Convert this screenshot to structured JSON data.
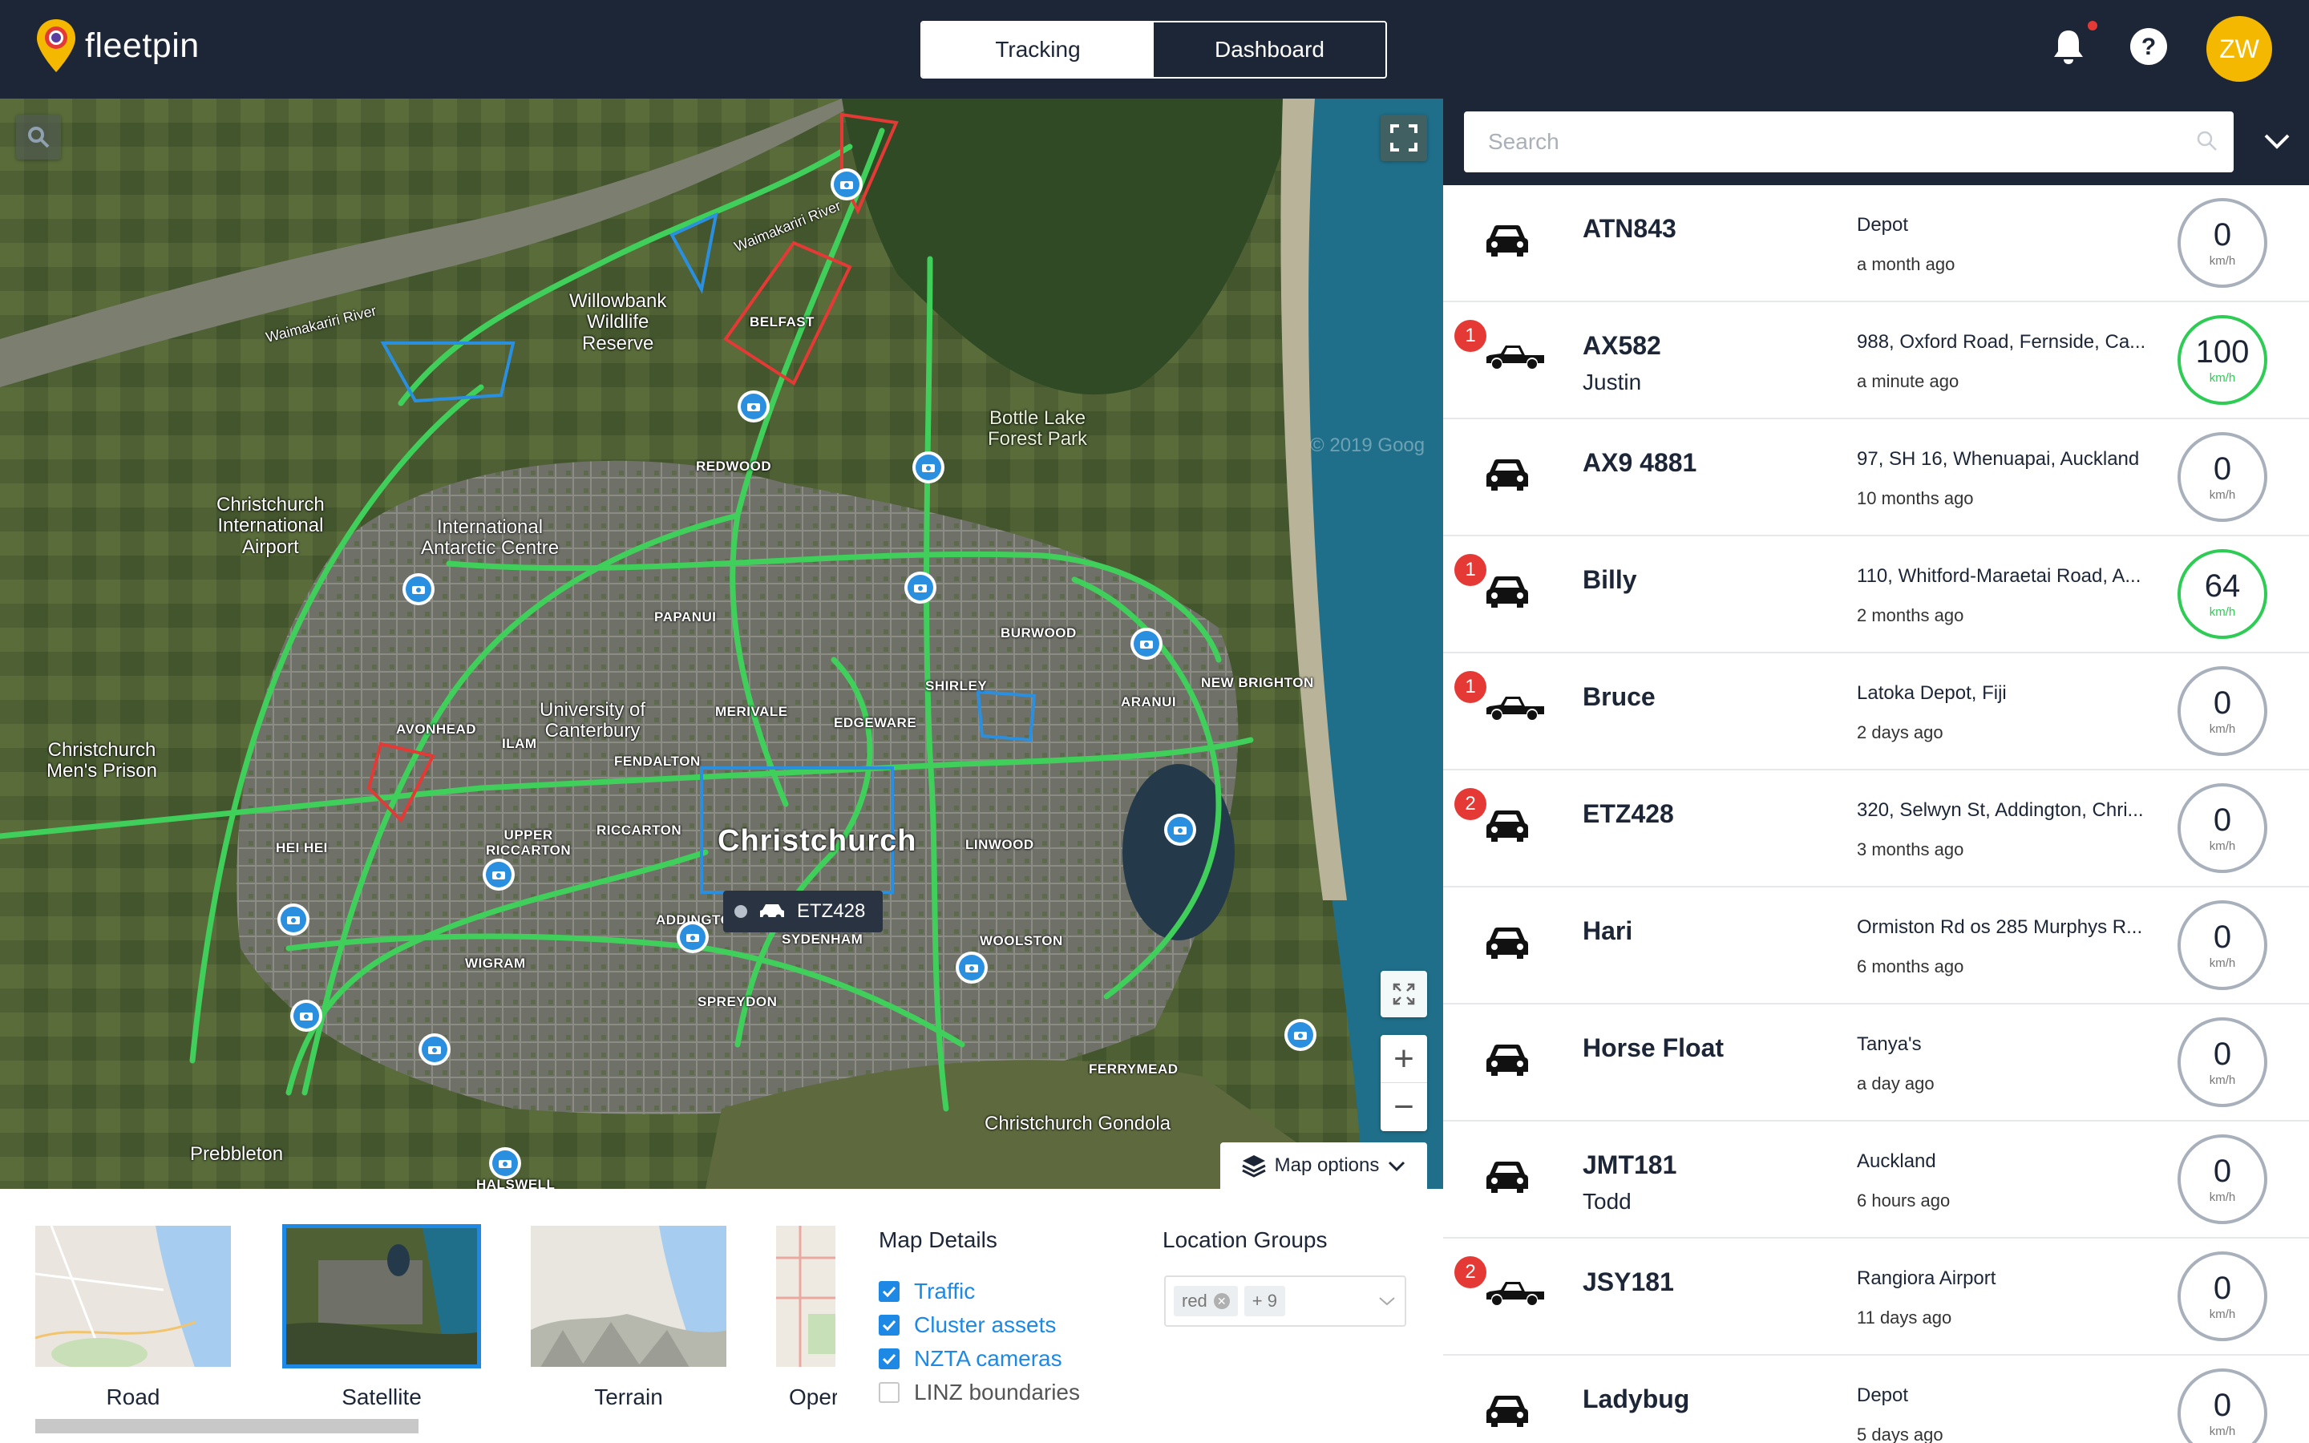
{
  "app": {
    "name": "fleetpin"
  },
  "header": {
    "tabs": [
      {
        "label": "Tracking",
        "active": true
      },
      {
        "label": "Dashboard",
        "active": false
      }
    ],
    "avatar_initials": "ZW",
    "icons": [
      "bell-icon",
      "help-icon"
    ]
  },
  "map": {
    "selected_vehicle": "ETZ428",
    "map_options_label": "Map options",
    "labels": {
      "christchurch": "Christchurch",
      "willowbank": "Willowbank\nWildlife\nReserve",
      "airport": "Christchurch\nInternational\nAirport",
      "antarctic": "International\nAntarctic Centre",
      "bottle_lake": "Bottle Lake\nForest Park",
      "university": "University of\nCanterbury",
      "prison": "Christchurch\nMen's Prison",
      "prebbleton": "Prebbleton",
      "gondola": "Christchurch Gondola",
      "belfast": "BELFAST",
      "redwood": "REDWOOD",
      "papanui": "PAPANUI",
      "burwood": "BURWOOD",
      "shirley": "SHIRLEY",
      "aranui": "ARANUI",
      "new_brighton": "NEW BRIGHTON",
      "merivale": "MERIVALE",
      "edgeware": "EDGEWARE",
      "avonhead": "AVONHEAD",
      "ilam": "ILAM",
      "fendalton": "FENDALTON",
      "riccarton": "RICCARTON",
      "upper_riccarton": "UPPER\nRICCARTON",
      "hei_hei": "HEI HEI",
      "linwood": "LINWOOD",
      "wigram": "WIGRAM",
      "sydenham": "SYDENHAM",
      "addington": "ADDINGTO",
      "spreydon": "SPREYDON",
      "woolston": "WOOLSTON",
      "ferrymead": "FERRYMEAD",
      "halswell": "HALSWELL",
      "waimakariri_river_1": "Waimakariri River",
      "waimakariri_river_2": "Waimakariri River",
      "copyright": "© 2019 Goog"
    }
  },
  "map_panel": {
    "map_types": [
      {
        "label": "Road",
        "selected": false
      },
      {
        "label": "Satellite",
        "selected": true
      },
      {
        "label": "Terrain",
        "selected": false
      },
      {
        "label": "Oper",
        "selected": false
      }
    ],
    "map_details_title": "Map Details",
    "details": [
      {
        "label": "Traffic",
        "checked": true
      },
      {
        "label": "Cluster assets",
        "checked": true
      },
      {
        "label": "NZTA cameras",
        "checked": true
      },
      {
        "label": "LINZ boundaries",
        "checked": false
      }
    ],
    "location_groups_title": "Location Groups",
    "location_groups_tag": "red",
    "location_groups_more": "+ 9"
  },
  "search": {
    "placeholder": "Search"
  },
  "vehicles": [
    {
      "name": "ATN843",
      "driver": "",
      "address": "Depot",
      "time": "a month ago",
      "speed": "0",
      "alerts": "",
      "type": "car"
    },
    {
      "name": "AX582",
      "driver": "Justin",
      "address": "988, Oxford Road, Fernside, Ca...",
      "time": "a minute ago",
      "speed": "100",
      "alerts": "1",
      "type": "ute"
    },
    {
      "name": "AX9 4881",
      "driver": "",
      "address": "97, SH 16, Whenuapai, Auckland",
      "time": "10 months ago",
      "speed": "0",
      "alerts": "",
      "type": "car"
    },
    {
      "name": "Billy",
      "driver": "",
      "address": "110, Whitford-Maraetai Road, A...",
      "time": "2 months ago",
      "speed": "64",
      "alerts": "1",
      "type": "car"
    },
    {
      "name": "Bruce",
      "driver": "",
      "address": "Latoka Depot, Fiji",
      "time": "2 days ago",
      "speed": "0",
      "alerts": "1",
      "type": "ute"
    },
    {
      "name": "ETZ428",
      "driver": "",
      "address": "320, Selwyn St, Addington, Chri...",
      "time": "3 months ago",
      "speed": "0",
      "alerts": "2",
      "type": "car"
    },
    {
      "name": "Hari",
      "driver": "",
      "address": "Ormiston Rd os 285 Murphys R...",
      "time": "6 months ago",
      "speed": "0",
      "alerts": "",
      "type": "car"
    },
    {
      "name": "Horse Float",
      "driver": "",
      "address": "Tanya's",
      "time": "a day ago",
      "speed": "0",
      "alerts": "",
      "type": "car"
    },
    {
      "name": "JMT181",
      "driver": "Todd",
      "address": "Auckland",
      "time": "6 hours ago",
      "speed": "0",
      "alerts": "",
      "type": "car"
    },
    {
      "name": "JSY181",
      "driver": "",
      "address": "Rangiora Airport",
      "time": "11 days ago",
      "speed": "0",
      "alerts": "2",
      "type": "ute"
    },
    {
      "name": "Ladybug",
      "driver": "",
      "address": "Depot",
      "time": "5 days ago",
      "speed": "0",
      "alerts": "",
      "type": "car"
    }
  ],
  "speed_unit": "km/h",
  "colors": {
    "header": "#1c2636",
    "accent": "#1e88e5",
    "moving": "#2ecc55",
    "alert": "#e53935",
    "avatar": "#f5b800",
    "traffic": "#3fcf5a"
  }
}
